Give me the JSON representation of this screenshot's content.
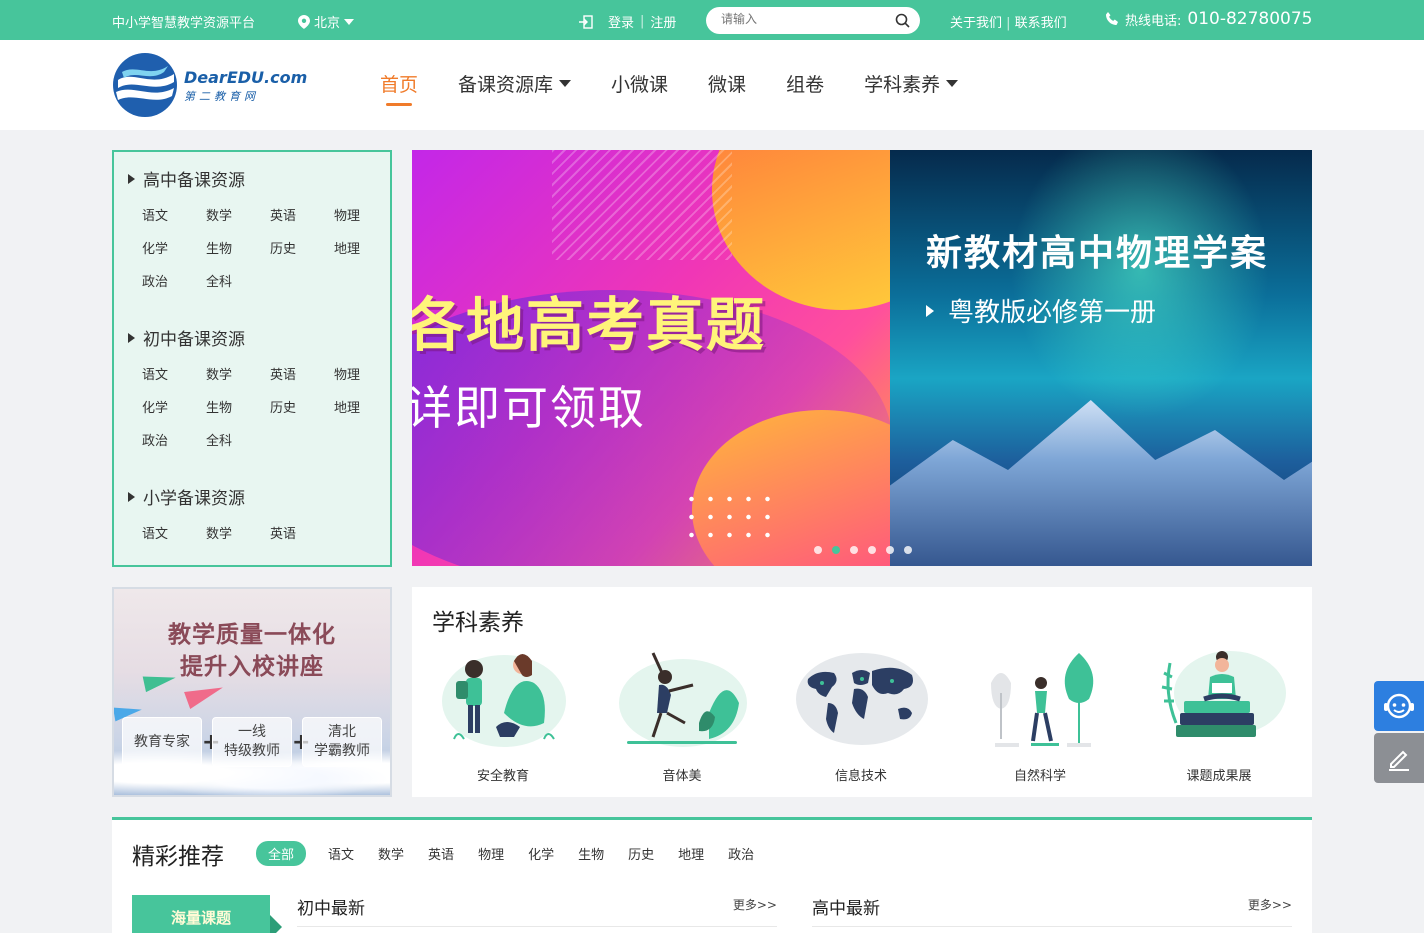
{
  "topbar": {
    "platform": "中小学智慧教学资源平台",
    "city": "北京",
    "login": "登录",
    "register": "注册",
    "search_placeholder": "请输入",
    "about": "关于我们",
    "contact": "联系我们",
    "hotline_label": "热线电话:",
    "hotline_number": "010-82780075",
    "bg_color": "#47c59b"
  },
  "header": {
    "logo_brand": "DearEDU.com",
    "logo_sub": "第二教育网",
    "nav": [
      {
        "label": "首页",
        "active": true
      },
      {
        "label": "备课资源库",
        "dropdown": true
      },
      {
        "label": "小微课"
      },
      {
        "label": "微课"
      },
      {
        "label": "组卷"
      },
      {
        "label": "学科素养",
        "dropdown": true
      }
    ],
    "active_color": "#f07b2a"
  },
  "categories": [
    {
      "title": "高中备课资源",
      "subjects": [
        "语文",
        "数学",
        "英语",
        "物理",
        "化学",
        "生物",
        "历史",
        "地理",
        "政治",
        "全科"
      ]
    },
    {
      "title": "初中备课资源",
      "subjects": [
        "语文",
        "数学",
        "英语",
        "物理",
        "化学",
        "生物",
        "历史",
        "地理",
        "政治",
        "全科"
      ]
    },
    {
      "title": "小学备课资源",
      "subjects": [
        "语文",
        "数学",
        "英语"
      ]
    }
  ],
  "banner": {
    "left_headline": "各地高考真题",
    "left_subline": "详即可领取",
    "right_title": "新教材高中物理学案",
    "right_subtitle": "粤教版必修第一册",
    "pager_count": 6,
    "pager_active": 1
  },
  "lecture": {
    "line1": "教学质量一体化",
    "line2": "提升入校讲座",
    "badges": [
      "教育专家",
      "一线\n特级教师",
      "清北\n学霸教师"
    ],
    "badge1": "教育专家",
    "badge2_top": "一线",
    "badge2_bottom": "特级教师",
    "badge3_top": "清北",
    "badge3_bottom": "学霸教师",
    "plus": "+"
  },
  "literacy": {
    "title": "学科素养",
    "items": [
      {
        "label": "安全教育",
        "icon": "safety-illustration"
      },
      {
        "label": "音体美",
        "icon": "dance-illustration"
      },
      {
        "label": "信息技术",
        "icon": "world-map-illustration"
      },
      {
        "label": "自然科学",
        "icon": "nature-illustration"
      },
      {
        "label": "课题成果展",
        "icon": "reading-illustration"
      }
    ]
  },
  "recommend": {
    "title": "精彩推荐",
    "tabs": [
      "全部",
      "语文",
      "数学",
      "英语",
      "物理",
      "化学",
      "生物",
      "历史",
      "地理",
      "政治"
    ],
    "active_tab": 0,
    "side_tag": "海量课题",
    "col1_title": "初中最新",
    "col2_title": "高中最新",
    "more": "更多>>"
  }
}
